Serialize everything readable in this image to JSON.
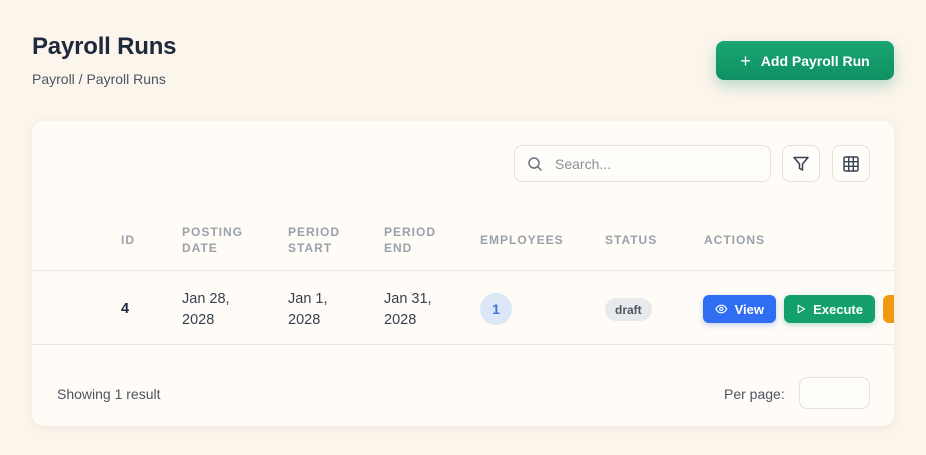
{
  "header": {
    "title": "Payroll Runs",
    "breadcrumb": "Payroll / Payroll Runs",
    "add_button_label": "Add Payroll Run"
  },
  "toolbar": {
    "search_placeholder": "Search..."
  },
  "table": {
    "columns": {
      "id": "ID",
      "posting_date": "POSTING DATE",
      "period_start": "PERIOD START",
      "period_end": "PERIOD END",
      "employees": "EMPLOYEES",
      "status": "STATUS",
      "actions": "ACTIONS"
    },
    "rows": [
      {
        "id": "4",
        "posting_date": "Jan 28, 2028",
        "period_start": "Jan 1, 2028",
        "period_end": "Jan 31, 2028",
        "employees": "1",
        "status": "draft",
        "actions": {
          "view": "View",
          "execute": "Execute"
        }
      }
    ]
  },
  "footer": {
    "result_text": "Showing 1 result",
    "per_page_label": "Per page:",
    "per_page_value": ""
  },
  "colors": {
    "primary_green": "#13a06d",
    "view_blue": "#2f6ef0",
    "warning_orange": "#ef9a10",
    "background": "#fcf5ec"
  }
}
